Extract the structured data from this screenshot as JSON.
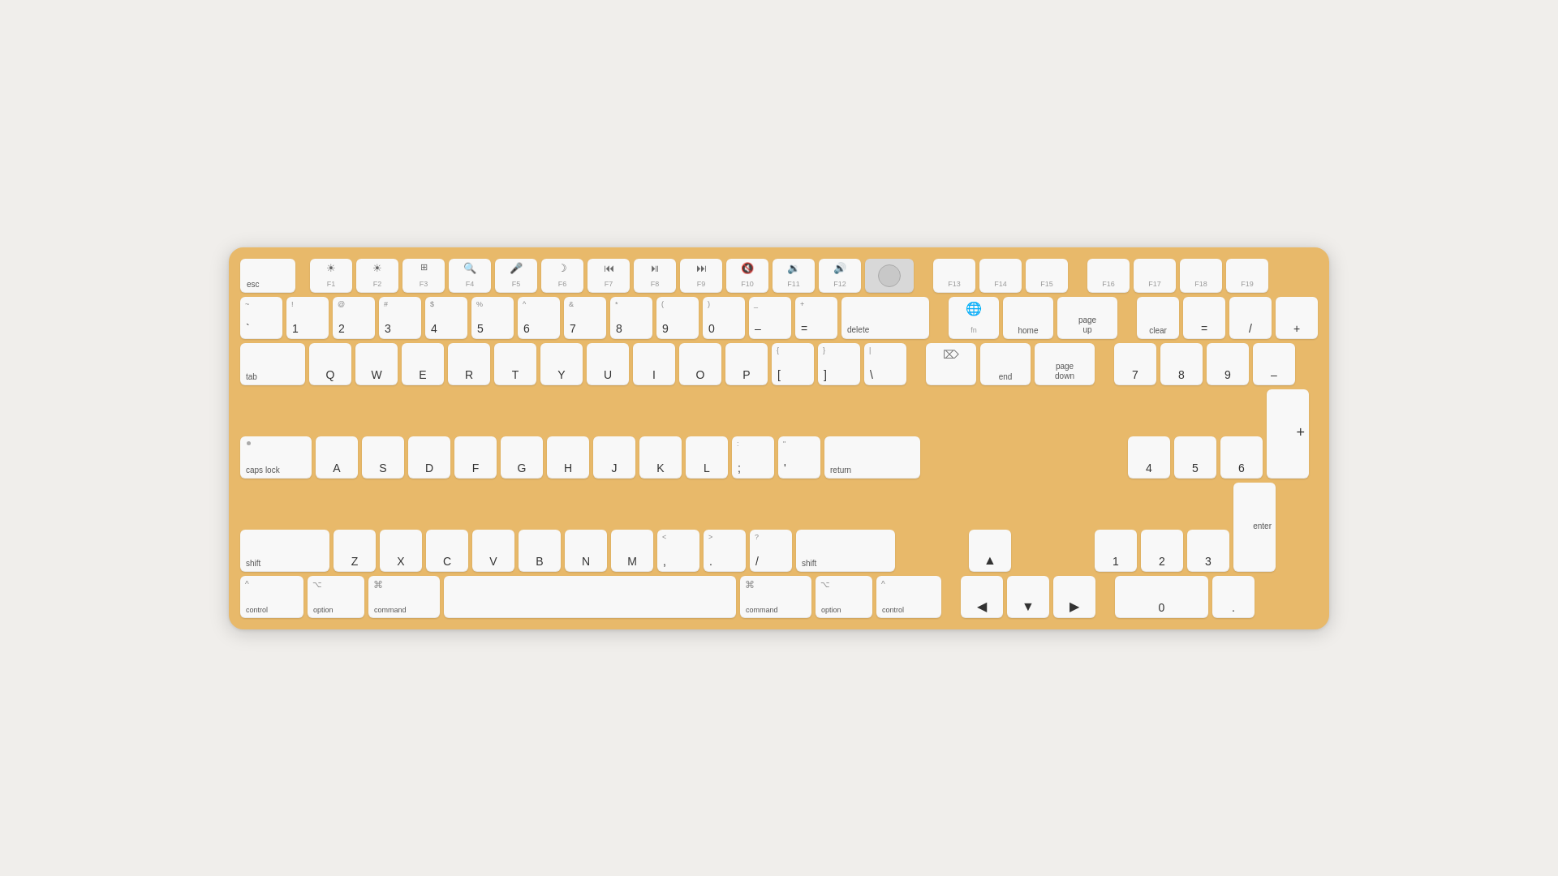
{
  "keyboard": {
    "color": "#e8b96a",
    "rows": {
      "fn": [
        "esc",
        "F1",
        "F2",
        "F3",
        "F4",
        "F5",
        "F6",
        "F7",
        "F8",
        "F9",
        "F10",
        "F11",
        "F12",
        "touch_id",
        "F13",
        "F14",
        "F15",
        "F16",
        "F17",
        "F18",
        "F19"
      ],
      "num": [
        "~`",
        "!1",
        "@2",
        "#3",
        "$4",
        "%5",
        "^6",
        "&7",
        "*8",
        "(9",
        ")0",
        "-",
        "+=",
        "delete",
        "fn",
        "home",
        "page_up",
        "clear",
        "=",
        "/ ",
        "+ "
      ],
      "tab": [
        "tab",
        "Q",
        "W",
        "E",
        "R",
        "T",
        "Y",
        "U",
        "I",
        "O",
        "P",
        "{ [",
        "} ]",
        "| \\",
        "del",
        "end",
        "page_down",
        "7 ",
        "8 ",
        "9 ",
        "- "
      ],
      "caps": [
        "caps",
        "A",
        "S",
        "D",
        "F",
        "G",
        "H",
        "J",
        "K",
        "L",
        ":;",
        "\"'",
        "return",
        "4 ",
        "5 ",
        "6 ",
        "+ "
      ],
      "shift": [
        "shift_l",
        "Z",
        "X",
        "C",
        "V",
        "B",
        "N",
        "M",
        "< ,",
        "> .",
        "? /",
        "shift_r",
        "up",
        "1 ",
        "2 ",
        "3 "
      ],
      "mod": [
        "control_l",
        "option_l",
        "command_l",
        "space",
        "command_r",
        "option_r",
        "control_r",
        "left",
        "down",
        "right",
        "0 ",
        ". ",
        "enter"
      ]
    }
  }
}
